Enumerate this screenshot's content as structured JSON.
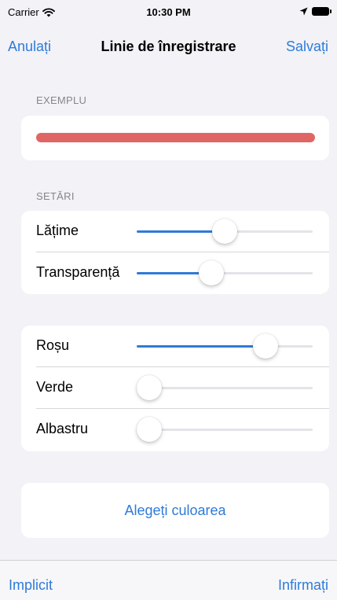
{
  "status_bar": {
    "carrier": "Carrier",
    "time": "10:30 PM",
    "wifi_icon": "wifi-icon",
    "location_icon": "location-arrow-icon",
    "battery_icon": "battery-icon"
  },
  "nav": {
    "cancel": "Anulați",
    "title": "Linie de înregistrare",
    "save": "Salvați"
  },
  "sample": {
    "header": "EXEMPLU",
    "line_color": "#e06666"
  },
  "settings": {
    "header": "SETĂRI",
    "rows": [
      {
        "label": "Lățime",
        "value": 0.5
      },
      {
        "label": "Transparență",
        "value": 0.41
      }
    ]
  },
  "color": {
    "rows": [
      {
        "label": "Roșu",
        "value": 0.77
      },
      {
        "label": "Verde",
        "value": 0.0
      },
      {
        "label": "Albastru",
        "value": 0.0
      }
    ]
  },
  "choose_color": "Alegeți culoarea",
  "toolbar": {
    "default": "Implicit",
    "info": "Infirmați"
  },
  "colors": {
    "accent": "#2f7bd8",
    "background": "#f2f2f7",
    "track": "#e3e3e8"
  }
}
